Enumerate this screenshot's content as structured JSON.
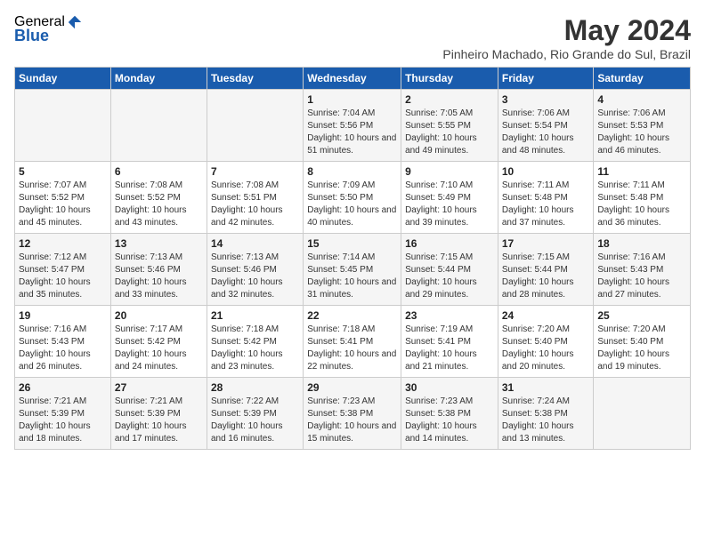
{
  "logo": {
    "general": "General",
    "blue": "Blue"
  },
  "title": "May 2024",
  "location": "Pinheiro Machado, Rio Grande do Sul, Brazil",
  "days_of_week": [
    "Sunday",
    "Monday",
    "Tuesday",
    "Wednesday",
    "Thursday",
    "Friday",
    "Saturday"
  ],
  "weeks": [
    [
      {
        "day": "",
        "sunrise": "",
        "sunset": "",
        "daylight": ""
      },
      {
        "day": "",
        "sunrise": "",
        "sunset": "",
        "daylight": ""
      },
      {
        "day": "",
        "sunrise": "",
        "sunset": "",
        "daylight": ""
      },
      {
        "day": "1",
        "sunrise": "7:04 AM",
        "sunset": "5:56 PM",
        "daylight": "10 hours and 51 minutes."
      },
      {
        "day": "2",
        "sunrise": "7:05 AM",
        "sunset": "5:55 PM",
        "daylight": "10 hours and 49 minutes."
      },
      {
        "day": "3",
        "sunrise": "7:06 AM",
        "sunset": "5:54 PM",
        "daylight": "10 hours and 48 minutes."
      },
      {
        "day": "4",
        "sunrise": "7:06 AM",
        "sunset": "5:53 PM",
        "daylight": "10 hours and 46 minutes."
      }
    ],
    [
      {
        "day": "5",
        "sunrise": "7:07 AM",
        "sunset": "5:52 PM",
        "daylight": "10 hours and 45 minutes."
      },
      {
        "day": "6",
        "sunrise": "7:08 AM",
        "sunset": "5:52 PM",
        "daylight": "10 hours and 43 minutes."
      },
      {
        "day": "7",
        "sunrise": "7:08 AM",
        "sunset": "5:51 PM",
        "daylight": "10 hours and 42 minutes."
      },
      {
        "day": "8",
        "sunrise": "7:09 AM",
        "sunset": "5:50 PM",
        "daylight": "10 hours and 40 minutes."
      },
      {
        "day": "9",
        "sunrise": "7:10 AM",
        "sunset": "5:49 PM",
        "daylight": "10 hours and 39 minutes."
      },
      {
        "day": "10",
        "sunrise": "7:11 AM",
        "sunset": "5:48 PM",
        "daylight": "10 hours and 37 minutes."
      },
      {
        "day": "11",
        "sunrise": "7:11 AM",
        "sunset": "5:48 PM",
        "daylight": "10 hours and 36 minutes."
      }
    ],
    [
      {
        "day": "12",
        "sunrise": "7:12 AM",
        "sunset": "5:47 PM",
        "daylight": "10 hours and 35 minutes."
      },
      {
        "day": "13",
        "sunrise": "7:13 AM",
        "sunset": "5:46 PM",
        "daylight": "10 hours and 33 minutes."
      },
      {
        "day": "14",
        "sunrise": "7:13 AM",
        "sunset": "5:46 PM",
        "daylight": "10 hours and 32 minutes."
      },
      {
        "day": "15",
        "sunrise": "7:14 AM",
        "sunset": "5:45 PM",
        "daylight": "10 hours and 31 minutes."
      },
      {
        "day": "16",
        "sunrise": "7:15 AM",
        "sunset": "5:44 PM",
        "daylight": "10 hours and 29 minutes."
      },
      {
        "day": "17",
        "sunrise": "7:15 AM",
        "sunset": "5:44 PM",
        "daylight": "10 hours and 28 minutes."
      },
      {
        "day": "18",
        "sunrise": "7:16 AM",
        "sunset": "5:43 PM",
        "daylight": "10 hours and 27 minutes."
      }
    ],
    [
      {
        "day": "19",
        "sunrise": "7:16 AM",
        "sunset": "5:43 PM",
        "daylight": "10 hours and 26 minutes."
      },
      {
        "day": "20",
        "sunrise": "7:17 AM",
        "sunset": "5:42 PM",
        "daylight": "10 hours and 24 minutes."
      },
      {
        "day": "21",
        "sunrise": "7:18 AM",
        "sunset": "5:42 PM",
        "daylight": "10 hours and 23 minutes."
      },
      {
        "day": "22",
        "sunrise": "7:18 AM",
        "sunset": "5:41 PM",
        "daylight": "10 hours and 22 minutes."
      },
      {
        "day": "23",
        "sunrise": "7:19 AM",
        "sunset": "5:41 PM",
        "daylight": "10 hours and 21 minutes."
      },
      {
        "day": "24",
        "sunrise": "7:20 AM",
        "sunset": "5:40 PM",
        "daylight": "10 hours and 20 minutes."
      },
      {
        "day": "25",
        "sunrise": "7:20 AM",
        "sunset": "5:40 PM",
        "daylight": "10 hours and 19 minutes."
      }
    ],
    [
      {
        "day": "26",
        "sunrise": "7:21 AM",
        "sunset": "5:39 PM",
        "daylight": "10 hours and 18 minutes."
      },
      {
        "day": "27",
        "sunrise": "7:21 AM",
        "sunset": "5:39 PM",
        "daylight": "10 hours and 17 minutes."
      },
      {
        "day": "28",
        "sunrise": "7:22 AM",
        "sunset": "5:39 PM",
        "daylight": "10 hours and 16 minutes."
      },
      {
        "day": "29",
        "sunrise": "7:23 AM",
        "sunset": "5:38 PM",
        "daylight": "10 hours and 15 minutes."
      },
      {
        "day": "30",
        "sunrise": "7:23 AM",
        "sunset": "5:38 PM",
        "daylight": "10 hours and 14 minutes."
      },
      {
        "day": "31",
        "sunrise": "7:24 AM",
        "sunset": "5:38 PM",
        "daylight": "10 hours and 13 minutes."
      },
      {
        "day": "",
        "sunrise": "",
        "sunset": "",
        "daylight": ""
      }
    ]
  ]
}
